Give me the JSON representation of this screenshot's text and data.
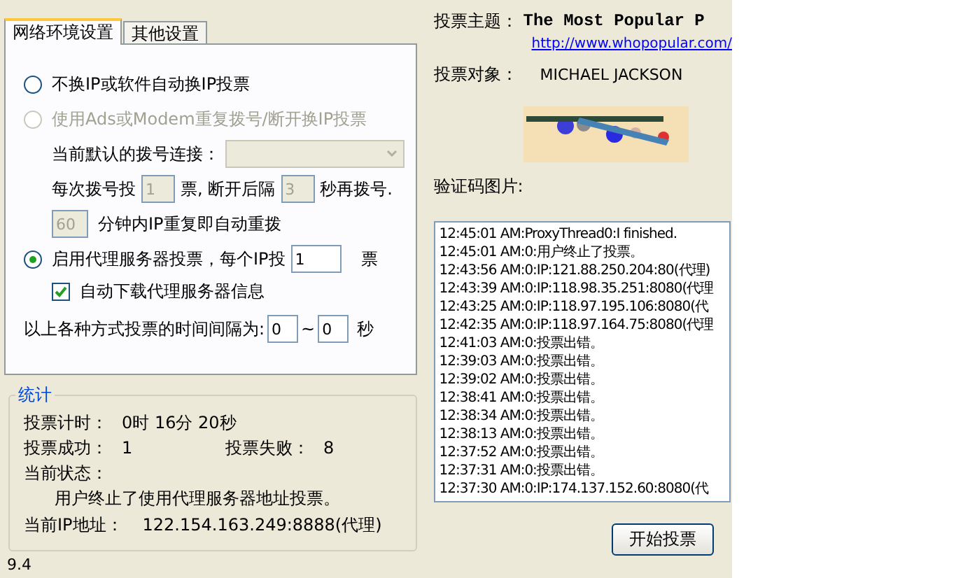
{
  "tabs": [
    {
      "label": "网络环境设置",
      "selected": true
    },
    {
      "label": "其他设置",
      "selected": false
    }
  ],
  "modes": [
    {
      "label": "不换IP或软件自动换IP投票",
      "selected": false,
      "disabled": false
    },
    {
      "label": "使用Ads或Modem重复拨号/断开换IP投票",
      "selected": false,
      "disabled": true
    },
    {
      "label": "启用代理服务器投票，每个IP投",
      "selected": true,
      "disabled": false
    }
  ],
  "dial": {
    "connection_label": "当前默认的拨号连接：",
    "votes_label": "每次拨号投",
    "votes_value": "1",
    "wait_label": "票, 断开后隔",
    "wait_value": "3",
    "redial_label": "秒再拨号.",
    "repeat_value": "60",
    "repeat_label": "分钟内IP重复即自动重拨",
    "disabled": true
  },
  "proxy": {
    "votes_value": "1",
    "votes_unit": "票",
    "auto_download": {
      "label": "自动下载代理服务器信息",
      "checked": true
    }
  },
  "interval": {
    "label": "以上各种方式投票的时间间隔为:",
    "from": "0",
    "sep": "~",
    "to": "0",
    "unit": "秒"
  },
  "stats": {
    "title": "统计",
    "timer_label": "投票计时：",
    "timer_value": "0时 16分 20秒",
    "success_label": "投票成功：",
    "success_value": "1",
    "fail_label": "投票失败：",
    "fail_value": "8",
    "status_label": "当前状态：",
    "status_value": "用户终止了使用代理服务器地址投票。",
    "ip_label": "当前IP地址：",
    "ip_value": "122.154.163.249:8888(代理)"
  },
  "version": "9.4",
  "vote": {
    "topic_label": "投票主题：",
    "topic": "The Most Popular P",
    "url": "http://www.whopopular.com/",
    "target_label": "投票对象：",
    "target": "MICHAEL JACKSON",
    "captcha_label": "验证码图片:"
  },
  "log": [
    "12:45:01 AM:ProxyThread0:I finished.",
    "12:45:01 AM:0:用户终止了投票。",
    "12:43:56 AM:0:IP:121.88.250.204:80(代理)",
    "12:43:39 AM:0:IP:118.98.35.251:8080(代理",
    "12:43:25 AM:0:IP:118.97.195.106:8080(代",
    "12:42:35 AM:0:IP:118.97.164.75:8080(代理",
    "12:41:03 AM:0:投票出错。",
    "12:39:03 AM:0:投票出错。",
    "12:39:02 AM:0:投票出错。",
    "12:38:41 AM:0:投票出错。",
    "12:38:34 AM:0:投票出错。",
    "12:38:13 AM:0:投票出错。",
    "12:37:52 AM:0:投票出错。",
    "12:37:31 AM:0:投票出错。",
    "12:37:30 AM:0:IP:174.137.152.60:8080(代"
  ],
  "start_button": "开始投票"
}
